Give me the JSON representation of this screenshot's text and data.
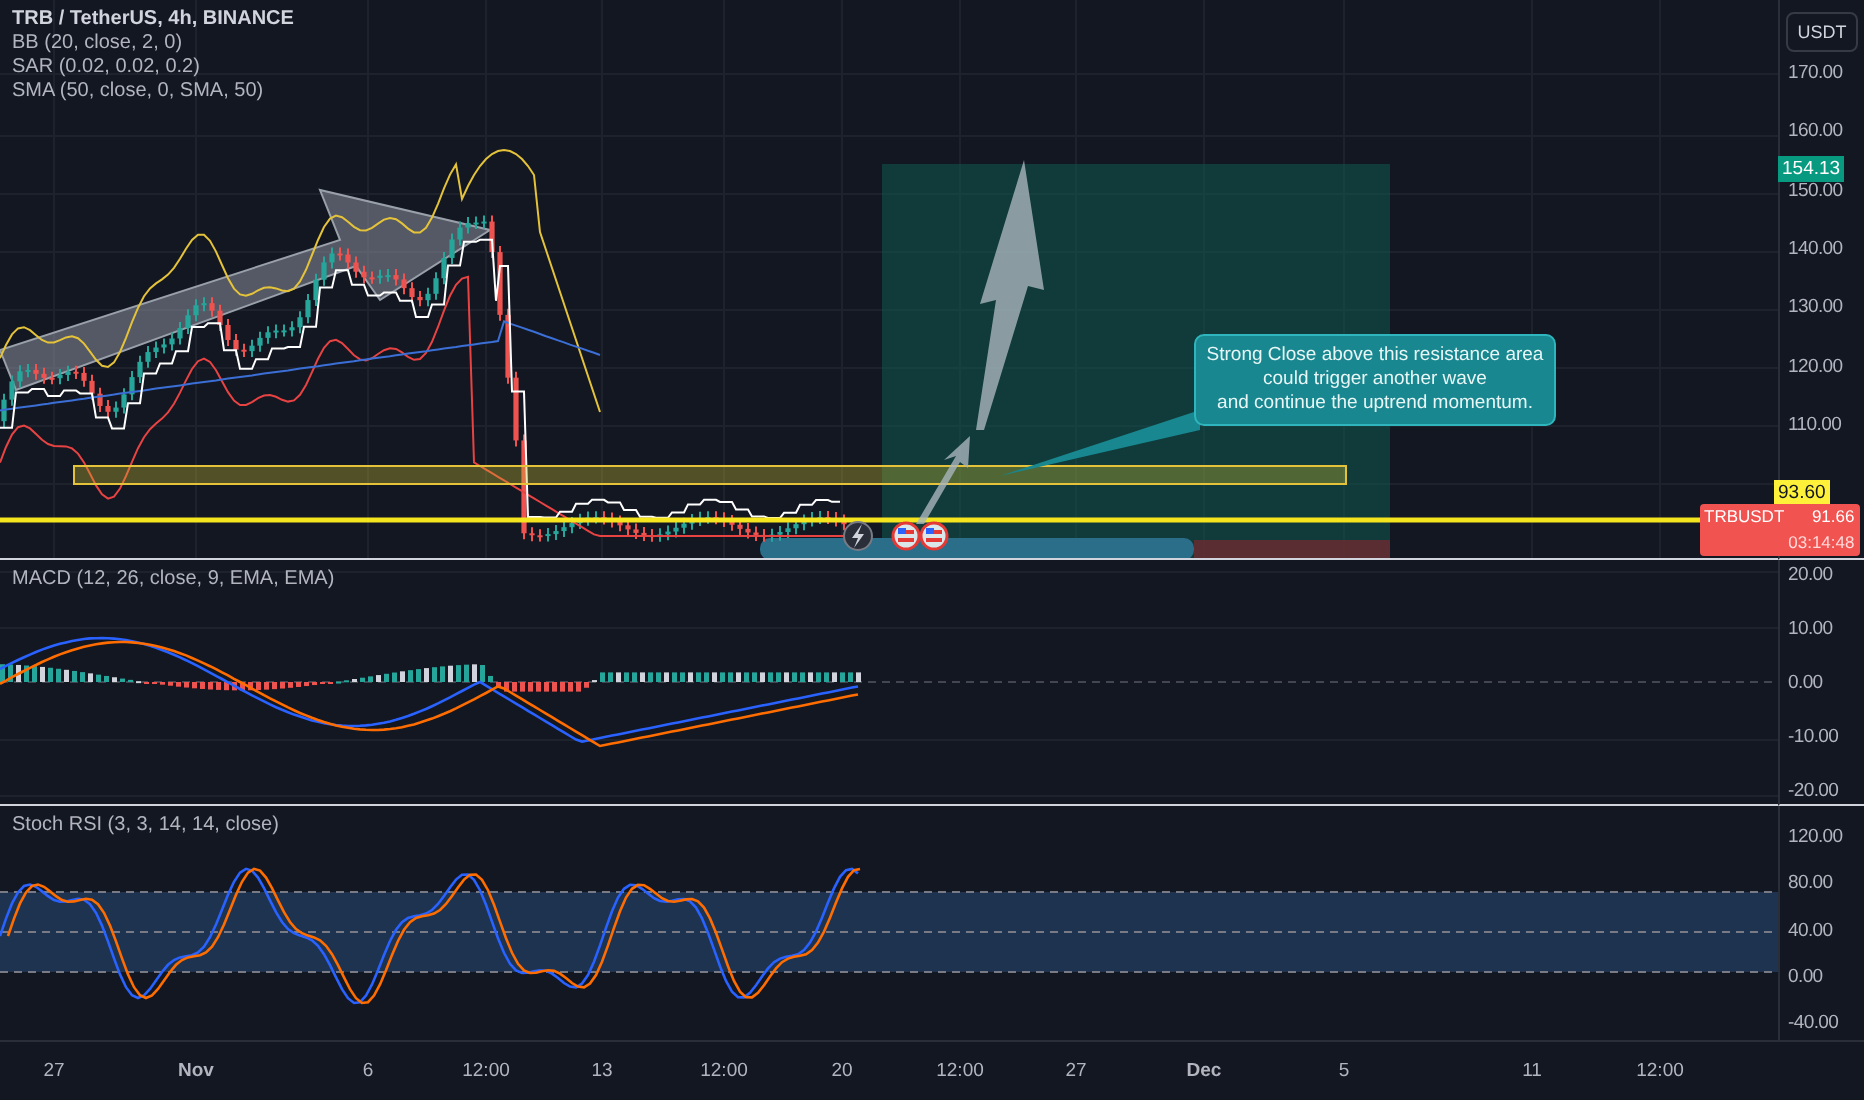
{
  "legend": {
    "title": "TRB / TetherUS, 4h, BINANCE",
    "indicators": [
      "BB (20, close, 2, 0)",
      "SAR (0.02, 0.02, 0.2)",
      "SMA (50, close, 0, SMA, 50)"
    ]
  },
  "currency_button": "USDT",
  "price_axis": {
    "ticks": [
      "170.00",
      "160.00",
      "150.00",
      "140.00",
      "130.00",
      "120.00",
      "110.00"
    ],
    "target_badge": "154.13",
    "level_badge": "93.60",
    "last_price": {
      "symbol": "TRBUSDT",
      "price": "91.66",
      "countdown": "03:14:48"
    }
  },
  "callout": {
    "lines": [
      "Strong Close above this resistance area",
      "could trigger another wave",
      "and continue the uptrend momentum."
    ]
  },
  "macd_pane": {
    "title": "MACD (12, 26, close, 9, EMA, EMA)",
    "ticks": [
      "20.00",
      "10.00",
      "0.00",
      "-10.00",
      "-20.00"
    ]
  },
  "stoch_pane": {
    "title": "Stoch RSI (3, 3, 14, 14, close)",
    "ticks": [
      "120.00",
      "80.00",
      "40.00",
      "0.00",
      "-40.00"
    ]
  },
  "time_axis": [
    {
      "label": "27",
      "bold": false
    },
    {
      "label": "Nov",
      "bold": true
    },
    {
      "label": "6",
      "bold": false
    },
    {
      "label": "12:00",
      "bold": false
    },
    {
      "label": "13",
      "bold": false
    },
    {
      "label": "12:00",
      "bold": false
    },
    {
      "label": "20",
      "bold": false
    },
    {
      "label": "12:00",
      "bold": false
    },
    {
      "label": "27",
      "bold": false
    },
    {
      "label": "Dec",
      "bold": true
    },
    {
      "label": "5",
      "bold": false
    },
    {
      "label": "11",
      "bold": false
    },
    {
      "label": "12:00",
      "bold": false
    }
  ]
}
